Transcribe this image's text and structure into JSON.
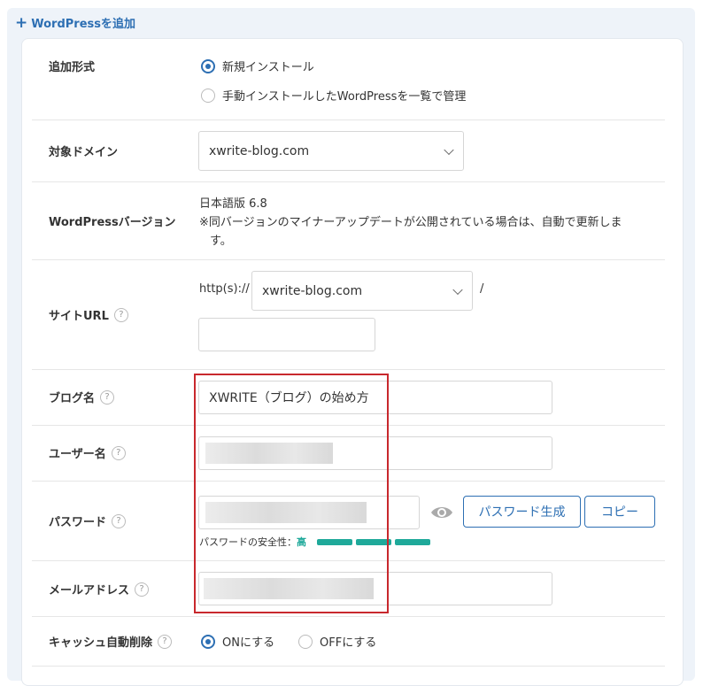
{
  "section": {
    "plus": "+",
    "title": "WordPressを追加"
  },
  "add_type": {
    "label": "追加形式",
    "options": [
      "新規インストール",
      "手動インストールしたWordPressを一覧で管理"
    ],
    "selected_index": 0
  },
  "domain": {
    "label": "対象ドメイン",
    "value": "xwrite-blog.com"
  },
  "version": {
    "label": "WordPressバージョン",
    "value": "日本語版 6.8",
    "note_line1": "※同バージョンのマイナーアップデートが公開されている場合は、自動で更新しま",
    "note_line2": "す。"
  },
  "site_url": {
    "label": "サイトURL",
    "prefix": "http(s)://",
    "domain": "xwrite-blog.com",
    "slash": "/",
    "path": ""
  },
  "blog_name": {
    "label": "ブログ名",
    "value": "XWRITE（ブログ）の始め方"
  },
  "username": {
    "label": "ユーザー名"
  },
  "password": {
    "label": "パスワード",
    "generate_button": "パスワード生成",
    "copy_button": "コピー",
    "strength_label": "パスワードの安全性：",
    "strength_value": "高"
  },
  "email": {
    "label": "メールアドレス"
  },
  "cache": {
    "label": "キャッシュ自動削除",
    "on": "ONにする",
    "off": "OFFにする",
    "selected": "on"
  },
  "help_glyph": "?",
  "colors": {
    "accent": "#2d6fb3",
    "strength": "#1fa99a",
    "highlight": "#c8282d"
  }
}
